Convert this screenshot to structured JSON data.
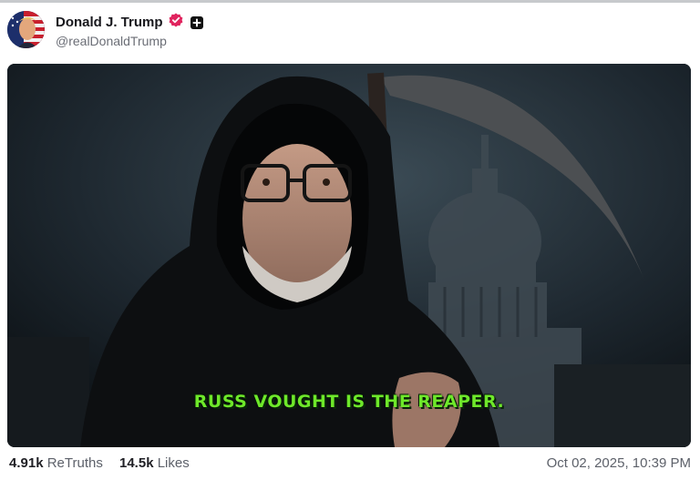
{
  "post": {
    "author_name": "Donald J. Trump",
    "handle": "@realDonaldTrump",
    "image_caption": "RUSS VOUGHT IS THE REAPER.",
    "retruths_count": "4.91k",
    "retruths_label": "ReTruths",
    "likes_count": "14.5k",
    "likes_label": "Likes",
    "timestamp": "Oct 02, 2025, 10:39 PM"
  },
  "icons": {
    "verified": "verified-badge-icon",
    "plus": "plus-badge-icon"
  },
  "colors": {
    "verified_badge": "#e0245e",
    "caption_text": "#6ee82a"
  }
}
